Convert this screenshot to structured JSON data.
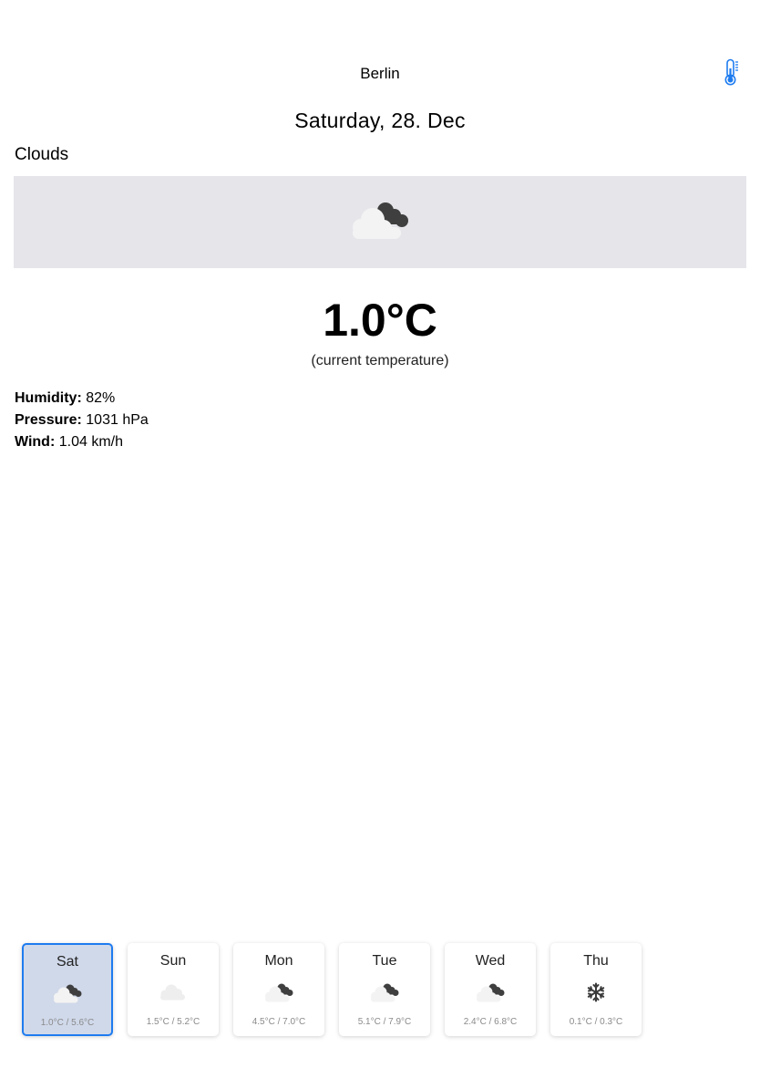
{
  "header": {
    "city": "Berlin",
    "units_button_icon": "thermometer-icon",
    "accent_color": "#1e7cf0"
  },
  "current": {
    "date": "Saturday, 28. Dec",
    "condition": "Clouds",
    "condition_icon": "cloud-moon-icon",
    "temperature": "1.0°C",
    "temperature_caption": "(current temperature)"
  },
  "details": {
    "humidity_label": "Humidity:",
    "humidity_value": "82%",
    "pressure_label": "Pressure:",
    "pressure_value": "1031 hPa",
    "wind_label": "Wind:",
    "wind_value": "1.04 km/h"
  },
  "forecast": {
    "selected_index": 0,
    "days": [
      {
        "day": "Sat",
        "icon": "cloud-moon-icon",
        "range": "1.0°C / 5.6°C"
      },
      {
        "day": "Sun",
        "icon": "cloud-icon",
        "range": "1.5°C / 5.2°C"
      },
      {
        "day": "Mon",
        "icon": "cloud-moon-icon",
        "range": "4.5°C / 7.0°C"
      },
      {
        "day": "Tue",
        "icon": "cloud-moon-icon",
        "range": "5.1°C / 7.9°C"
      },
      {
        "day": "Wed",
        "icon": "cloud-moon-icon",
        "range": "2.4°C / 6.8°C"
      },
      {
        "day": "Thu",
        "icon": "snowflake-icon",
        "range": "0.1°C / 0.3°C"
      }
    ]
  }
}
